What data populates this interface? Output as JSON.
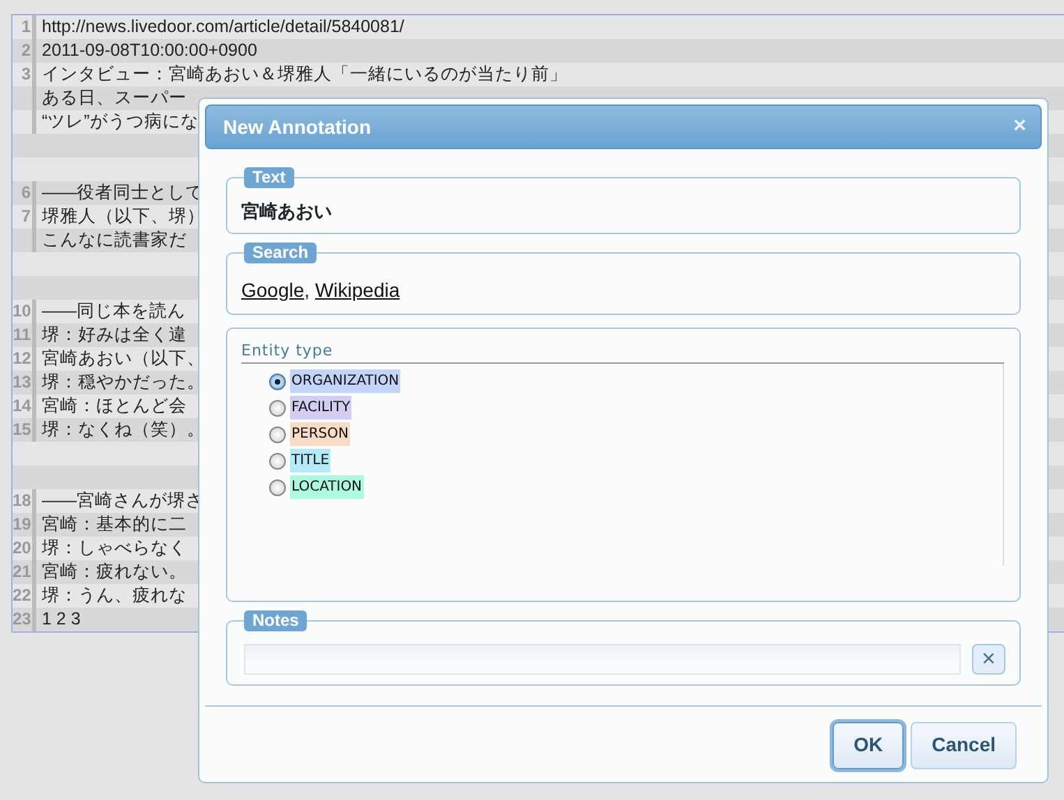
{
  "editor": {
    "lines": [
      {
        "number": "1",
        "text": "http://news.livedoor.com/article/detail/5840081/"
      },
      {
        "number": "2",
        "text": "2011-09-08T10:00:00+0900"
      },
      {
        "number": "3",
        "text": "インタビュー：宮崎あおい＆堺雅人「一緒にいるのが当たり前」"
      },
      {
        "text": "ある日、スーパー"
      },
      {
        "text": "“ツレ”がうつ病にな"
      },
      {
        "kind": "blank"
      },
      {
        "kind": "blank"
      },
      {
        "number": "6",
        "text": "——役者同士として"
      },
      {
        "number": "7",
        "text": "堺雅人（以下、堺）"
      },
      {
        "text": "こんなに読書家だ"
      },
      {
        "kind": "blank"
      },
      {
        "kind": "blank"
      },
      {
        "number": "10",
        "text": "——同じ本を読ん"
      },
      {
        "number": "11",
        "text": "堺：好みは全く違"
      },
      {
        "number": "12",
        "text": "宮崎あおい（以下、"
      },
      {
        "number": "13",
        "text": "堺：穏やかだった。"
      },
      {
        "number": "14",
        "text": "宮崎：ほとんど会"
      },
      {
        "number": "15",
        "text": "堺：なくね（笑）。"
      },
      {
        "kind": "blank"
      },
      {
        "kind": "blank"
      },
      {
        "number": "18",
        "text": "——宮崎さんが堺さ"
      },
      {
        "number": "19",
        "text": "宮崎：基本的に二"
      },
      {
        "number": "20",
        "text": "堺：しゃべらなく"
      },
      {
        "number": "21",
        "text": "宮崎：疲れない。"
      },
      {
        "number": "22",
        "text": "堺：うん、疲れな"
      },
      {
        "number": "23",
        "text": "1 2 3"
      }
    ]
  },
  "dialog": {
    "title": "New Annotation",
    "close": "×",
    "text_section": {
      "legend": "Text",
      "value": "宮崎あおい"
    },
    "search_section": {
      "legend": "Search",
      "links": [
        "Google",
        "Wikipedia"
      ],
      "separator": ", "
    },
    "entity_section": {
      "legend": "Entity type",
      "options": [
        {
          "label": "ORGANIZATION",
          "selected": true,
          "color": "#c4d4f8"
        },
        {
          "label": "FACILITY",
          "selected": false,
          "color": "#d2cdf2"
        },
        {
          "label": "PERSON",
          "selected": false,
          "color": "#fadcc6"
        },
        {
          "label": "TITLE",
          "selected": false,
          "color": "#b4eafa"
        },
        {
          "label": "LOCATION",
          "selected": false,
          "color": "#acfae2"
        }
      ]
    },
    "notes_section": {
      "legend": "Notes",
      "clear": "×"
    },
    "buttons": [
      {
        "label": "OK",
        "selected": true
      },
      {
        "label": "Cancel",
        "selected": false
      }
    ]
  }
}
